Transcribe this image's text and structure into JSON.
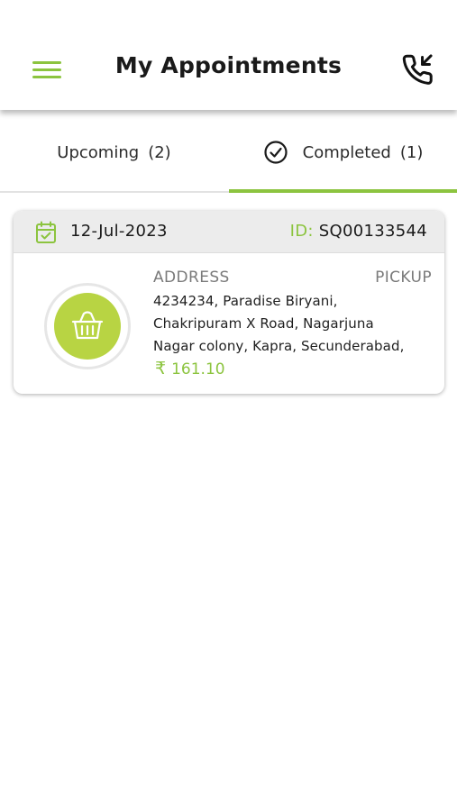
{
  "header": {
    "title": "My Appointments",
    "menu_icon": "hamburger-menu-icon",
    "call_icon": "incoming-call-icon"
  },
  "tabs": [
    {
      "label": "Upcoming",
      "count": "(2)",
      "active": false
    },
    {
      "label": "Completed",
      "count": "(1)",
      "active": true,
      "icon": "check-circle-icon"
    }
  ],
  "appointments": [
    {
      "date": "12-Jul-2023",
      "id_label": "ID:",
      "id": "SQ00133544",
      "address_label": "ADDRESS",
      "type": "PICKUP",
      "address_lines": [
        "4234234, Paradise Biryani,",
        "Chakripuram X Road, Nagarjuna",
        "Nagar colony, Kapra, Secunderabad,"
      ],
      "currency": "₹",
      "amount": "161.10",
      "icon": "basket-icon"
    }
  ],
  "colors": {
    "accent": "#8cc43f",
    "basket_bg": "#b8d443",
    "card_header_bg": "#ececec"
  }
}
